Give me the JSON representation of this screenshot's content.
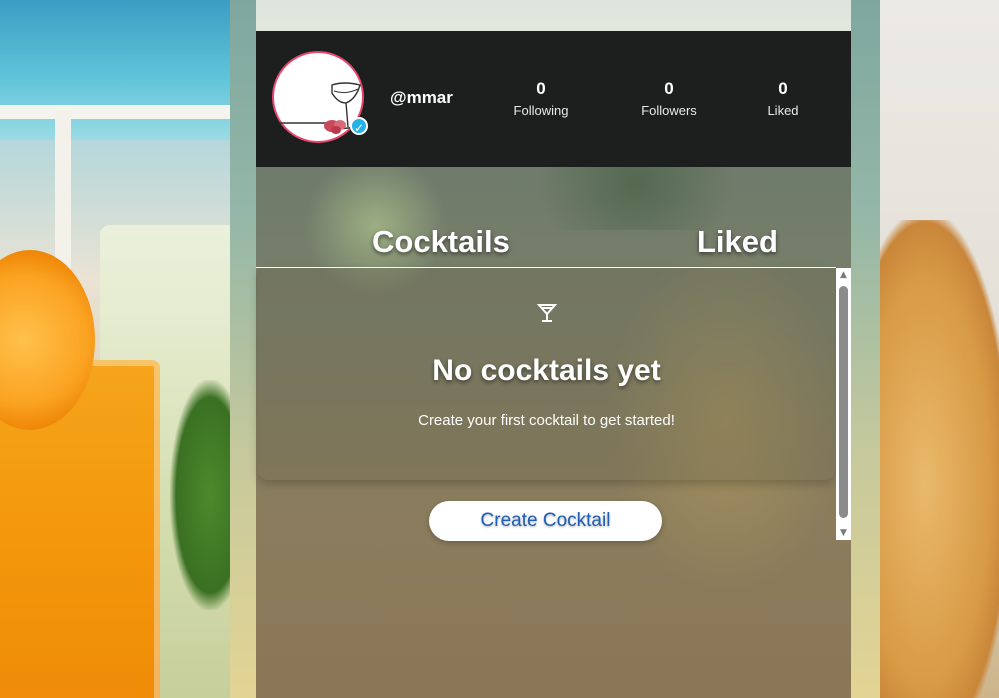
{
  "profile": {
    "username": "@mmar",
    "verified_icon": "check-badge-icon",
    "stats": [
      {
        "value": "0",
        "label": "Following"
      },
      {
        "value": "0",
        "label": "Followers"
      },
      {
        "value": "0",
        "label": "Liked"
      }
    ]
  },
  "tabs": [
    {
      "label": "Cocktails"
    },
    {
      "label": "Liked"
    }
  ],
  "empty_state": {
    "icon": "cocktail-glass-icon",
    "title": "No cocktails yet",
    "subtitle": "Create your first cocktail to get started!"
  },
  "actions": {
    "create_label": "Create Cocktail"
  },
  "colors": {
    "header_bg": "#1d1f1e",
    "avatar_ring": "#e7476e",
    "verified": "#23b3e6",
    "button_text": "#1f5fb5"
  }
}
